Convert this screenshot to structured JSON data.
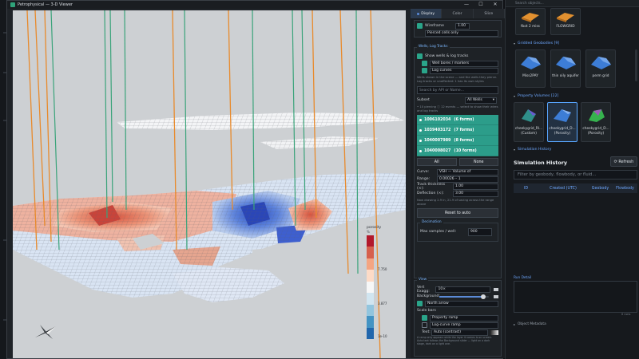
{
  "window": {
    "title": "Petrophysical — 3-D Viewer",
    "buttons": [
      "—",
      "☐",
      "✕"
    ]
  },
  "viewport": {
    "color_bar": {
      "title": "porosity",
      "subtitle": "%",
      "ticks": [
        "7.750",
        "3.877",
        "1e-10"
      ],
      "colors": [
        "#b2182b",
        "#d6604d",
        "#f4a582",
        "#fddbc7",
        "#f7f7f7",
        "#d1e5f0",
        "#92c5de",
        "#4393c3",
        "#2166ac"
      ]
    }
  },
  "panel": {
    "tabs": [
      {
        "label": "Display",
        "active": true
      },
      {
        "label": "Color",
        "active": false
      },
      {
        "label": "Slice",
        "active": false
      }
    ],
    "wireframe": {
      "label": "Wireframe",
      "value": "1.00",
      "checked": true
    },
    "pierced": {
      "label": "Pierced cells only",
      "checked": false
    },
    "well_section": {
      "title": "Wells, Log Tracks",
      "show_wells": {
        "label": "Show wells & log tracks",
        "checked": true
      },
      "well_bores": {
        "label": "Well bores / markers",
        "checked": false
      },
      "log_curves": {
        "label": "Log curves",
        "checked": false
      },
      "hint": "Wells shown in the scene — and the wells they pierce. Log tracks or unaffected: 1 has its own styles",
      "search_placeholder": "Search by API or Name...",
      "subset_label": "Subset",
      "subset_value": "All Wells",
      "count_hint": "• 10 piercing  ⓘ 12 events — select to show their wires and log tracks",
      "wells": [
        {
          "id": "1006102034",
          "forms": "(6 forms)"
        },
        {
          "id": "1039403172",
          "forms": "(7 forms)"
        },
        {
          "id": "1040007989",
          "forms": "(8 forms)"
        },
        {
          "id": "1040008027",
          "forms": "(10 forms)"
        }
      ],
      "all_button": "All",
      "none_button": "None",
      "curve_label": "Curve:",
      "curve_value": "VSH — Volume of",
      "range_label": "Range:",
      "range_value": "0.00026 – 1",
      "track_label": "Track thickness (×):",
      "track_value": "1.00",
      "deflection_label": "Deflection (×):",
      "deflection_value": "3.00",
      "drawing_hint": "Now drawing 2.9 in, 21.9 of saving across the range above",
      "reset_button": "Reset to auto",
      "decimation_title": "Decimation",
      "max_samples_label": "Max samples / well:",
      "max_samples_value": "900"
    },
    "view_section": {
      "title": "View",
      "vert_exag_label": "Vert Exagg:",
      "vert_exag_value": "10×",
      "background_label": "Background:",
      "north_arrow": {
        "label": "North arrow",
        "checked": true
      },
      "scale_bars_label": "Scale bars",
      "property_ramp": {
        "label": "Property ramp",
        "checked": true
      },
      "log_curve_ramp": {
        "label": "Log-curve ramp",
        "checked": false
      },
      "text_label": "Text:",
      "text_value": "Auto (contrast)",
      "footer_hint": "A ramp only appears while the layer it names is on screen. Auto text follows the Background slider — light on a dark stage, dark on a light one."
    }
  },
  "right_app": {
    "search_placeholder": "Search objects...",
    "top_items": [
      {
        "label": "fbot 2 miss"
      },
      {
        "label": "FLOWGRID"
      }
    ],
    "gridded": {
      "title": "Gridded Geobodies",
      "count": "[9]",
      "items": [
        {
          "label": "Miss2PAY"
        },
        {
          "label": "thin oily aquifer"
        },
        {
          "label": "perm grid"
        }
      ]
    },
    "property": {
      "title": "Property Volumes",
      "count": "[22]",
      "items": [
        {
          "label": "cheekygrid_RI...",
          "sub": "(Custom)",
          "selected": false
        },
        {
          "label": "cheekygrid_D...",
          "sub": "(Porosity)",
          "selected": true
        },
        {
          "label": "cheekygrid_D...",
          "sub": "(Porosity)",
          "selected": false
        }
      ]
    },
    "sim_history": {
      "section_title": "Simulation History",
      "heading": "Simulation History",
      "refresh_button": "⟳ Refresh",
      "filter_placeholder": "Filter by geobody, flowbody, or fluid...",
      "columns": [
        "ID",
        "Created (UTC)",
        "Geobody",
        "Flowbody"
      ]
    },
    "run_detail": {
      "title": "Run Detail",
      "runs": "0 runs"
    },
    "object_metadata": {
      "title": "Object Metadata"
    }
  }
}
